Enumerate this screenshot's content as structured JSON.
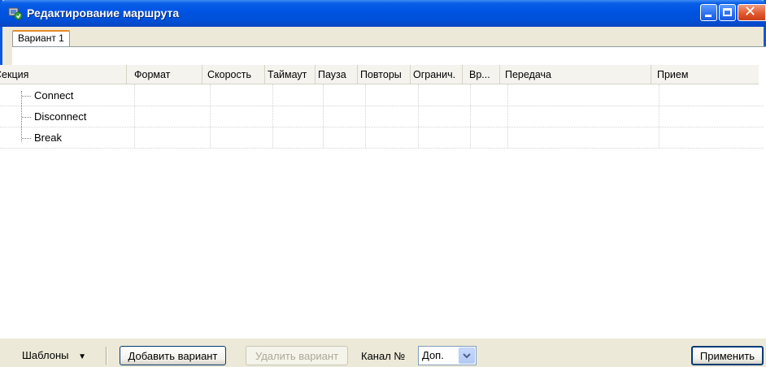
{
  "window": {
    "title": "Редактирование маршрута",
    "controls": {
      "minimize_icon": "minimize-icon",
      "maximize_icon": "maximize-icon",
      "close_icon": "close-icon",
      "close_glyph": "✕"
    }
  },
  "tabs": [
    {
      "label": "Вариант 1",
      "active": true
    }
  ],
  "table": {
    "columns": [
      "Секция",
      "Формат",
      "Скорость",
      "Таймаут",
      "Пауза",
      "Повторы",
      "Огранич.",
      "Вр...",
      "Передача",
      "Прием"
    ],
    "rows": [
      {
        "section": "Connect"
      },
      {
        "section": "Disconnect"
      },
      {
        "section": "Break"
      }
    ]
  },
  "footer": {
    "templates_label": "Шаблоны",
    "templates_arrow": "▼",
    "add_variant_label": "Добавить вариант",
    "delete_variant_label": "Удалить вариант",
    "channel_label": "Канал №",
    "channel_value": "Доп.",
    "apply_label": "Применить"
  },
  "colors": {
    "title_bar": "#0054e3",
    "window_bg": "#ece9d8",
    "tab_highlight": "#e68b2c"
  }
}
